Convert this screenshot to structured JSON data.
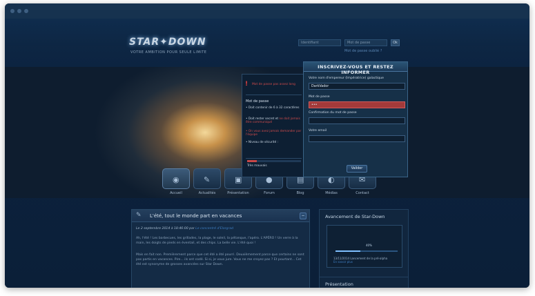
{
  "header": {
    "logo_text": "STAR✦DOWN",
    "tagline": "VOTRE AMBITION POUR SEULE LIMITE",
    "login_placeholder": "Identifiant",
    "password_placeholder": "Mot de passe",
    "ok_label": "Ok",
    "forgot_label": "Mot de passe oublié ?"
  },
  "nav": {
    "items": [
      {
        "label": "Accueil",
        "icon": "home-icon",
        "glyph": "◉"
      },
      {
        "label": "Actualités",
        "icon": "news-icon",
        "glyph": "✎"
      },
      {
        "label": "Présentation",
        "icon": "presentation-icon",
        "glyph": "▣"
      },
      {
        "label": "Forum",
        "icon": "forum-icon",
        "glyph": "●"
      },
      {
        "label": "Blog",
        "icon": "blog-icon",
        "glyph": "▤"
      },
      {
        "label": "Médias",
        "icon": "media-icon",
        "glyph": "◐"
      },
      {
        "label": "Contact",
        "icon": "contact-icon",
        "glyph": "✉"
      }
    ]
  },
  "main": {
    "title": "L'été, tout le monde part en vacances",
    "collapse_label": "−",
    "meta_date": "Le 2 septembre 2014 à 18:46:00 par",
    "meta_author": "Le concentré d'Elorgrad",
    "paragraph1": "Ah, l'été ! Les barbecues, les grillades, la plage, le soleil, la pétanque, l'apéro. L'APÉRO ! Un verre à la main, les doigts de pieds en éventail, et des chips. La belle vie. L'été quoi !",
    "paragraph2": "Mais en fait non. Premièrement parce que cet été a été pourri. Deuxièmement parce que certains ne sont pas partis en vacances. Pire... ils ont codé. Si si, je vous jure. Vous ne me croyez pas ? Et pourtant... Cet été est synonyme de grosses avancées sur Star Down."
  },
  "side": {
    "title": "Avancement de Star-Down",
    "progress_pct_label": "40%",
    "progress_value": 0.4,
    "note": "13/11/2014 Lancement de la pré-alpha",
    "note_link": "En savoir plus",
    "title2": "Présentation"
  },
  "tooltip": {
    "alert_text": "Mot de passe pas assez long",
    "heading": "Mot de passe",
    "rule1": "• Doit contenir de 6 à 32 caractères",
    "rule2_a": "• Doit rester secret et ",
    "rule2_b": "ne doit jamais être communiqué",
    "rule3": "• On vous avez jamais demander par l'équipe",
    "rule4": "• Niveau de sécurité :",
    "strength_value": 0.18,
    "strength_label": "Très mauvais"
  },
  "signup": {
    "title": "INSCRIVEZ-VOUS ET RESTEZ INFORMER",
    "name_label": "Votre nom d'empereur (Impératrice) galactique",
    "name_value": "DarkVador",
    "password_label": "Mot de passe",
    "password_value": "•••",
    "confirm_label": "Confirmation du mot de passe",
    "confirm_value": "",
    "email_label": "Votre email",
    "email_value": "",
    "submit_label": "Valider"
  }
}
